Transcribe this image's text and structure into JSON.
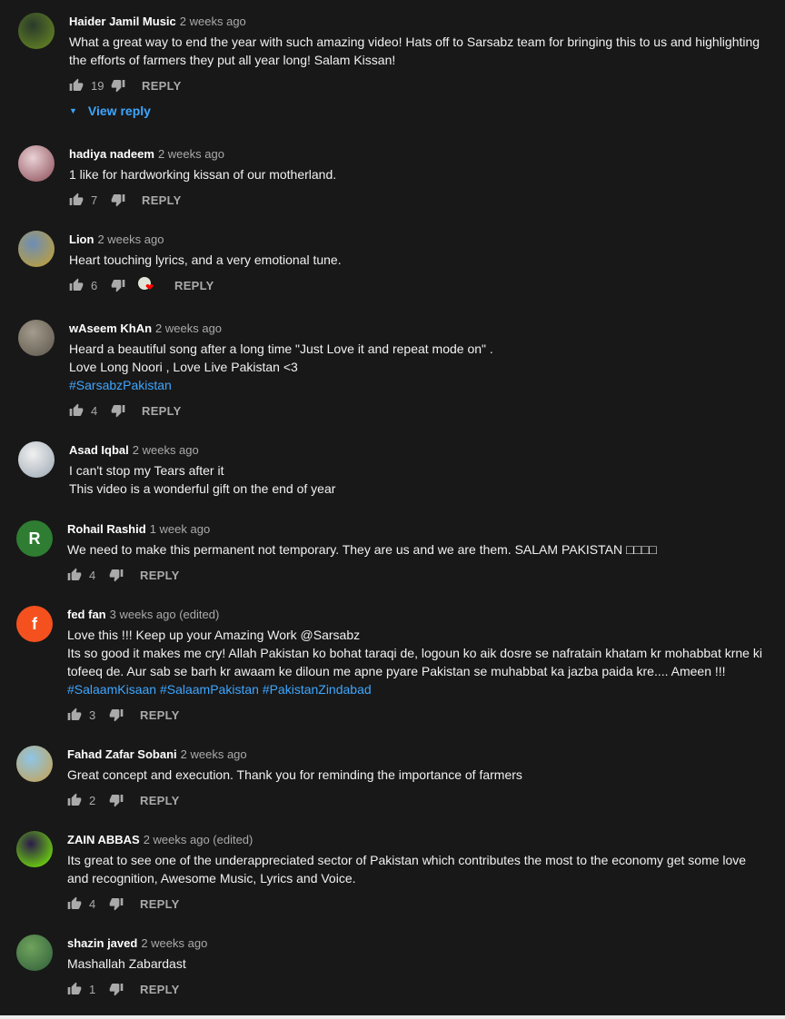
{
  "comments": [
    {
      "author": "Haider Jamil Music",
      "time": "2 weeks ago",
      "lines": [
        {
          "text": "What a great way to end the year with such amazing video! Hats off to Sarsabz team for bringing this to us and highlighting the efforts of farmers they put all year long! Salam Kissan!",
          "tag": false
        }
      ],
      "likes": "19",
      "reply_label": "REPLY",
      "view_reply": "View reply",
      "avatar": {
        "type": "image",
        "colors": [
          "#2a3a2a",
          "#6b8e23"
        ]
      }
    },
    {
      "author": "hadiya nadeem",
      "time": "2 weeks ago",
      "lines": [
        {
          "text": "1 like for hardworking kissan of our motherland.",
          "tag": false
        }
      ],
      "likes": "7",
      "reply_label": "REPLY",
      "avatar": {
        "type": "image",
        "colors": [
          "#e9d2d5",
          "#8b4a55"
        ]
      }
    },
    {
      "author": "Lion",
      "time": "2 weeks ago",
      "lines": [
        {
          "text": "Heart touching lyrics, and a very emotional tune.",
          "tag": false
        }
      ],
      "likes": "6",
      "heart": true,
      "reply_label": "REPLY",
      "avatar": {
        "type": "image",
        "colors": [
          "#6c8db8",
          "#c9a227"
        ]
      }
    },
    {
      "author": "wAseem KhAn",
      "time": "2 weeks ago",
      "lines": [
        {
          "text": "Heard a beautiful song after a long time \"Just Love it and repeat mode on\" .",
          "tag": false
        },
        {
          "text": "Love Long Noori , Love Live Pakistan <3",
          "tag": false
        },
        {
          "text": "#SarsabzPakistan",
          "tag": true
        }
      ],
      "likes": "4",
      "reply_label": "REPLY",
      "avatar": {
        "type": "image",
        "colors": [
          "#a39b8c",
          "#5b554a"
        ]
      }
    },
    {
      "author": "Asad Iqbal",
      "time": "2 weeks ago",
      "lines": [
        {
          "text": "I can't stop my Tears after it",
          "tag": false
        },
        {
          "text": "This video is a wonderful gift on the end of year",
          "tag": false
        }
      ],
      "avatar": {
        "type": "image",
        "colors": [
          "#f0f0f0",
          "#9aa6b2"
        ]
      }
    },
    {
      "author": "Rohail Rashid",
      "time": "1 week ago",
      "lines": [
        {
          "text": "We need to make this permanent not temporary. They are us and we are them. SALAM PAKISTAN □□□□",
          "tag": false
        }
      ],
      "likes": "4",
      "reply_label": "REPLY",
      "avatar": {
        "type": "letter",
        "letter": "R",
        "color": "#2e7d32"
      }
    },
    {
      "author": "fed fan",
      "time": "3 weeks ago (edited)",
      "lines": [
        {
          "text": "Love this !!! Keep up your Amazing Work @Sarsabz",
          "tag": false
        },
        {
          "text": "Its so good it makes me cry! Allah Pakistan ko bohat taraqi de, logoun ko aik dosre se nafratain khatam kr mohabbat krne ki tofeeq de. Aur sab se barh kr awaam ke diloun me apne pyare Pakistan se muhabbat ka jazba paida kre.... Ameen !!!",
          "tag": false
        },
        {
          "text": "#SalaamKisaan #SalaamPakistan #PakistanZindabad",
          "tag": true
        }
      ],
      "likes": "3",
      "reply_label": "REPLY",
      "avatar": {
        "type": "letter",
        "letter": "f",
        "color": "#f4511e"
      }
    },
    {
      "author": "Fahad Zafar Sobani",
      "time": "2 weeks ago",
      "lines": [
        {
          "text": "Great concept and execution. Thank you for reminding the importance of farmers",
          "tag": false
        }
      ],
      "likes": "2",
      "reply_label": "REPLY",
      "avatar": {
        "type": "image",
        "colors": [
          "#8ec5e8",
          "#c9a14a"
        ]
      }
    },
    {
      "author": "ZAIN ABBAS",
      "time": "2 weeks ago (edited)",
      "lines": [
        {
          "text": "Its great to see one of the underappreciated sector of Pakistan which contributes the most to the economy get some love and recognition, Awesome Music, Lyrics and Voice.",
          "tag": false
        }
      ],
      "likes": "4",
      "reply_label": "REPLY",
      "avatar": {
        "type": "image",
        "colors": [
          "#2b1a4a",
          "#7cfc00"
        ]
      }
    },
    {
      "author": "shazin javed",
      "time": "2 weeks ago",
      "lines": [
        {
          "text": "Mashallah Zabardast",
          "tag": false
        }
      ],
      "likes": "1",
      "reply_label": "REPLY",
      "avatar": {
        "type": "image",
        "colors": [
          "#6fa35c",
          "#2f5d3a"
        ]
      }
    }
  ]
}
